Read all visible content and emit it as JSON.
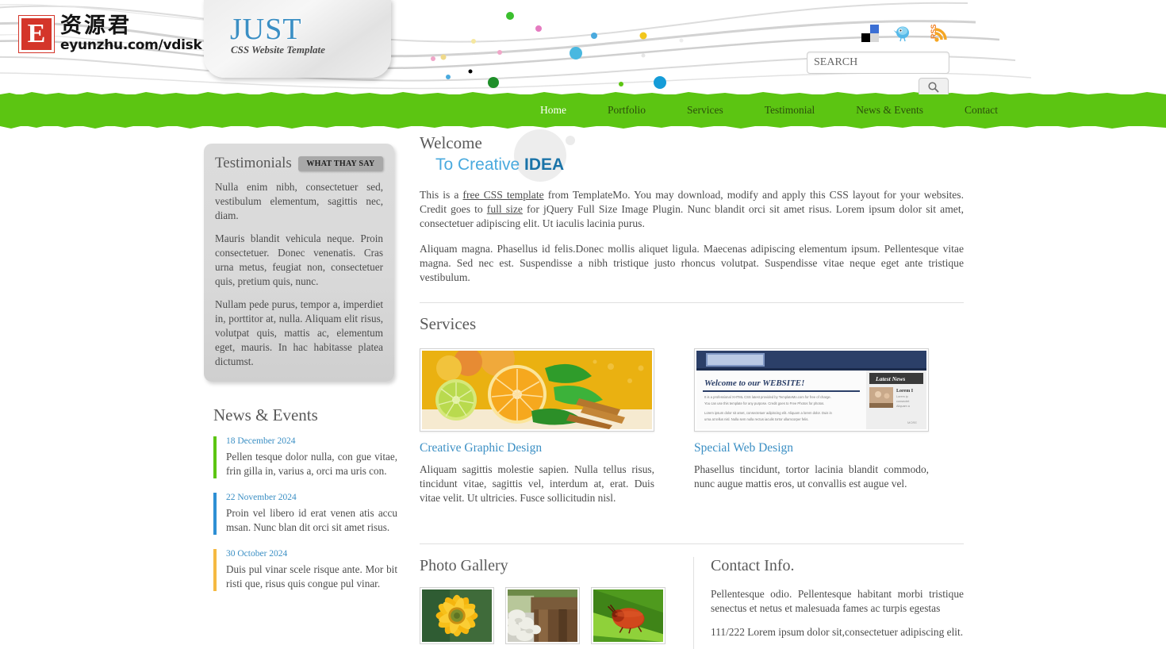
{
  "header": {
    "logo": {
      "mark_letter": "E",
      "cn_name": "资源君",
      "url": "eyunzhu.com/vdisk"
    },
    "brand": {
      "title": "JUST",
      "subtitle": "CSS Website Template"
    },
    "social": [
      {
        "name": "delicious-icon",
        "label": "del.icio.us"
      },
      {
        "name": "twitter-icon",
        "label": "Twitter"
      },
      {
        "name": "rss-icon",
        "label": "RSS"
      }
    ],
    "search": {
      "placeholder": "SEARCH",
      "value": "",
      "button_icon": "search-icon"
    }
  },
  "nav": {
    "items": [
      {
        "label": "Home",
        "active": true
      },
      {
        "label": "Portfolio",
        "active": false
      },
      {
        "label": "Services",
        "active": false
      },
      {
        "label": "Testimonial",
        "active": false
      },
      {
        "label": "News & Events",
        "active": false
      },
      {
        "label": "Contact",
        "active": false
      }
    ]
  },
  "sidebar": {
    "testimonials": {
      "title": "Testimonials",
      "badge": "WHAT THAY SAY",
      "paragraphs": [
        "Nulla enim nibh, consectetuer sed, vestibulum elementum, sagittis nec, diam.",
        "Mauris blandit vehicula neque. Proin consectetuer. Donec venenatis. Cras urna metus, feugiat non, consectetuer quis, pretium quis, nunc.",
        "Nullam pede purus, tempor a, imperdiet in, porttitor at, nulla. Aliquam elit risus, volutpat quis, mattis ac, elementum eget, mauris. In hac habitasse platea dictumst."
      ]
    },
    "news": {
      "title": "News & Events",
      "items": [
        {
          "date": "18 December 2024",
          "text": "Pellen tesque dolor nulla, con gue vitae, frin gilla in, varius a, orci ma uris con.",
          "accent": "#5cc512"
        },
        {
          "date": "22 November 2024",
          "text": "Proin vel libero id erat venen atis accu msan. Nunc blan dit orci sit amet risus.",
          "accent": "#2e8fd4"
        },
        {
          "date": "30 October 2024",
          "text": "Duis pul vinar scele risque ante. Mor bit risti que, risus quis congue pul vinar.",
          "accent": "#f5b council"
        }
      ]
    }
  },
  "main": {
    "welcome": {
      "line1": "Welcome",
      "line2_prefix": "To Creative ",
      "line2_strong": "IDEA"
    },
    "intro": {
      "part1": "This is a ",
      "link1": "free CSS template",
      "part2": " from TemplateMo. You may download, modify and apply this CSS layout for your websites. Credit goes to ",
      "link2": "full size",
      "part3": " for jQuery Full Size Image Plugin. Nunc blandit orci sit amet risus. Lorem ipsum dolor sit amet, consectetuer adipiscing elit. Ut iaculis lacinia purus."
    },
    "paragraph2": "Aliquam magna. Phasellus id felis.Donec mollis aliquet ligula. Maecenas adipiscing elementum ipsum. Pellentesque vitae magna. Sed nec est. Suspendisse a nibh tristique justo rhoncus volutpat. Suspendisse vitae neque eget ante tristique vestibulum.",
    "services": {
      "title": "Services",
      "items": [
        {
          "image_name": "fruit-photo",
          "link": "Creative Graphic Design",
          "desc": "Aliquam sagittis molestie sapien. Nulla tellus risus, tincidunt vitae, sagittis vel, interdum at, erat. Duis vitae velit. Ut ultricies. Fusce sollicitudin nisl."
        },
        {
          "image_name": "website-mockup",
          "link": "Special Web Design",
          "desc": "Phasellus tincidunt, tortor lacinia blandit commodo, nunc augue mattis eros, ut convallis est augue vel."
        }
      ]
    },
    "gallery": {
      "title": "Photo Gallery",
      "thumbs": [
        {
          "name": "sunflower-thumb"
        },
        {
          "name": "stones-thumb"
        },
        {
          "name": "beetle-thumb"
        }
      ]
    },
    "contact": {
      "title": "Contact Info.",
      "paragraphs": [
        "Pellentesque odio. Pellentesque habitant morbi tristique senectus et netus et malesuada fames ac turpis egestas",
        "111/222 Lorem ipsum dolor sit,consectetuer adipiscing elit."
      ]
    }
  },
  "colors": {
    "nav_green": "#5cc512",
    "link_blue": "#3b8fc4",
    "brand_blue": "#3b8fc4",
    "idea_blue": "#1a73a8"
  }
}
